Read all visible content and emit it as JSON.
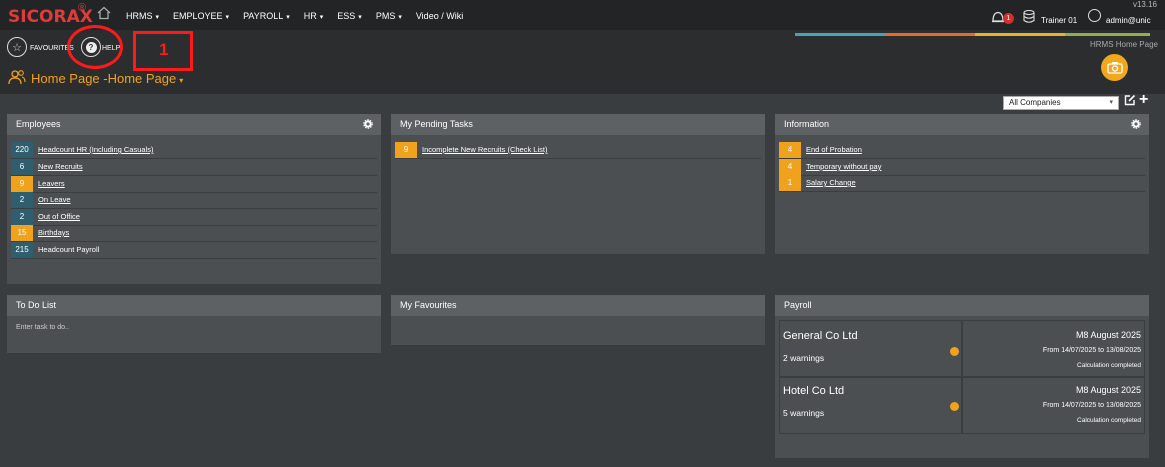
{
  "app": {
    "logo": "SICORAX",
    "logo_mark": "®",
    "version": "v13.16"
  },
  "nav": [
    {
      "label": "HRMS",
      "caret": "▾"
    },
    {
      "label": "EMPLOYEE",
      "caret": "▾"
    },
    {
      "label": "PAYROLL",
      "caret": "▾"
    },
    {
      "label": "HR",
      "caret": "▾"
    },
    {
      "label": "ESS",
      "caret": "▾"
    },
    {
      "label": "PMS",
      "caret": "▾"
    },
    {
      "label": "Video / Wiki",
      "caret": ""
    }
  ],
  "topright": {
    "notification_count": "1",
    "trainer": "Trainer 01",
    "user": "admin@unic"
  },
  "accent_colors": [
    "#4aa3b5",
    "#e36b2b",
    "#e5b52a",
    "#8fb04a"
  ],
  "toolbar": {
    "favourites": "FAVOURITES",
    "help": "HELP",
    "annotation_number": "1"
  },
  "page": {
    "title": "Home Page -Home Page",
    "caret": "▾",
    "hrms_home": "HRMS Home Page"
  },
  "filter": {
    "company": "All Companies",
    "caret": "▾",
    "plus": "+"
  },
  "employees": {
    "title": "Employees",
    "rows": [
      {
        "num": "220",
        "label": "Headcount HR (Including Casuals)",
        "color": "teal",
        "link": true
      },
      {
        "num": "6",
        "label": "New Recruits",
        "color": "teal",
        "link": true
      },
      {
        "num": "9",
        "label": "Leavers",
        "color": "orange",
        "link": true
      },
      {
        "num": "2",
        "label": "On Leave",
        "color": "teal",
        "link": true
      },
      {
        "num": "2",
        "label": "Out of Office",
        "color": "teal",
        "link": true
      },
      {
        "num": "15",
        "label": "Birthdays",
        "color": "orange",
        "link": true
      },
      {
        "num": "215",
        "label": "Headcount Payroll",
        "color": "teal",
        "link": false
      }
    ]
  },
  "pending": {
    "title": "My Pending Tasks",
    "rows": [
      {
        "num": "9",
        "label": "Incomplete New Recruits (Check List)"
      }
    ]
  },
  "information": {
    "title": "Information",
    "rows": [
      {
        "num": "4",
        "label": "End of Probation"
      },
      {
        "num": "4",
        "label": "Temporary without pay"
      },
      {
        "num": "1",
        "label": "Salary Change"
      }
    ]
  },
  "todo": {
    "title": "To Do List",
    "placeholder": "Enter task to do.."
  },
  "favourites": {
    "title": "My Favourites"
  },
  "payroll": {
    "title": "Payroll",
    "items": [
      {
        "company": "General Co Ltd",
        "warnings": "2 warnings",
        "period": "M8 August 2025",
        "range": "From 14/07/2025 to 13/08/2025",
        "status": "Calculation completed"
      },
      {
        "company": "Hotel Co Ltd",
        "warnings": "5 warnings",
        "period": "M8 August 2025",
        "range": "From 14/07/2025 to 13/08/2025",
        "status": "Calculation completed"
      }
    ]
  }
}
